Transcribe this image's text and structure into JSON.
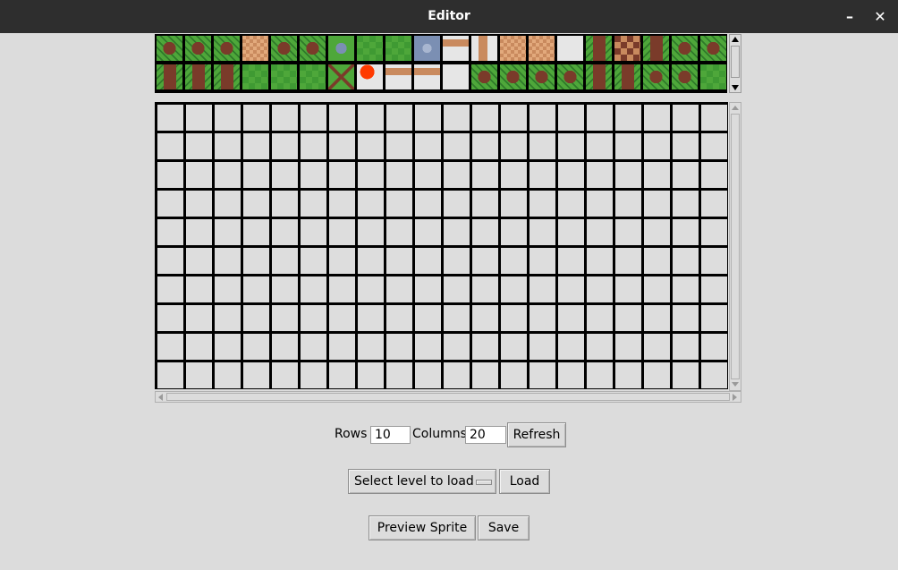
{
  "window": {
    "title": "Editor",
    "minimize_glyph": "–",
    "close_glyph": "✕"
  },
  "palette": {
    "colors": {
      "grass": "#4ea73a",
      "grass_dark": "#2f7a2a",
      "dirt": "#c98a5e",
      "dirt_dark": "#7a3b2a",
      "stone": "#7b8fb3",
      "blank": "#e6e6e6",
      "border": "#000000"
    },
    "rows": [
      [
        "grass-path",
        "grass-path",
        "grass-path",
        "dirt-tile",
        "grass-path",
        "grass-path",
        "grass-stone",
        "grass-check",
        "grass-check",
        "stone",
        "dirt-strip",
        "blank-dirt",
        "dirt-tile",
        "dirt-tile",
        "blank",
        "dirt-grass",
        "dirt-check",
        "dirt-grass",
        "grass-path",
        "grass-path"
      ],
      [
        "dirt-grass",
        "dirt-grass",
        "dirt-grass",
        "grass-check",
        "grass-check",
        "grass-check",
        "grass-x",
        "lava",
        "dirt-strip",
        "dirt-strip",
        "blank",
        "grass-path",
        "grass-path",
        "grass-path",
        "grass-path",
        "dirt-grass",
        "dirt-grass",
        "grass-path",
        "grass-path",
        "grass-check"
      ]
    ]
  },
  "grid": {
    "rows": 10,
    "columns": 20,
    "cell_color": "#dddddd"
  },
  "controls": {
    "rows_label": "Rows",
    "rows_value": "10",
    "columns_label": "Columns",
    "columns_value": "20",
    "refresh_label": "Refresh",
    "level_select_label": "Select level to load",
    "load_label": "Load",
    "preview_label": "Preview Sprite",
    "save_label": "Save"
  }
}
